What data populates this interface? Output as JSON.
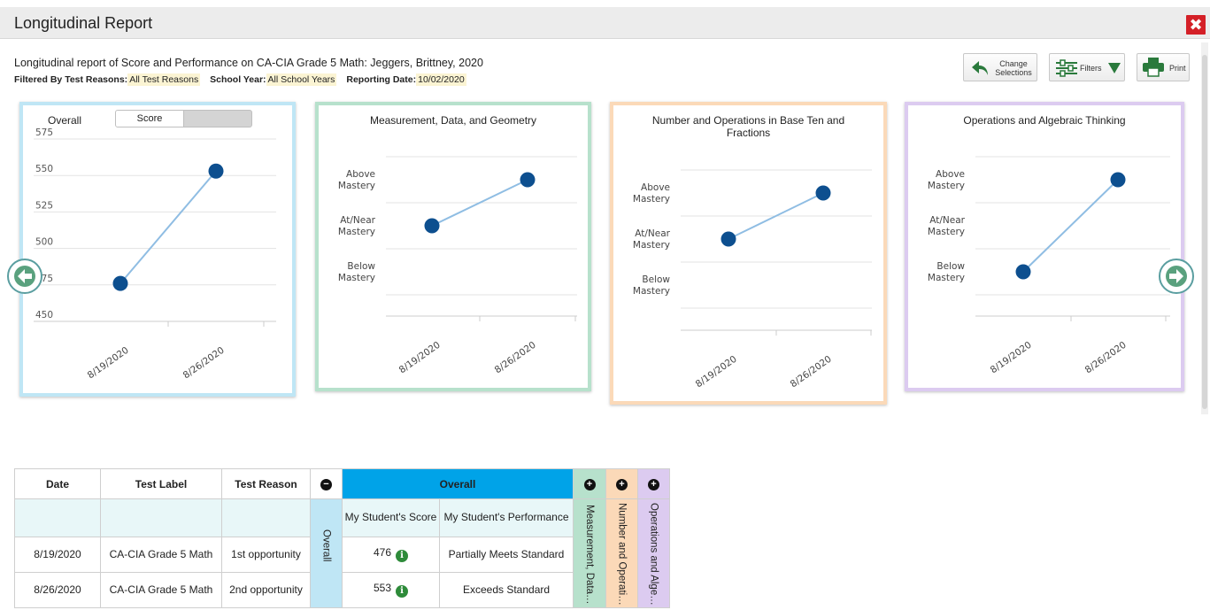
{
  "window": {
    "title": "Longitudinal Report",
    "close_icon": "close-icon"
  },
  "header": {
    "description": "Longitudinal report of Score and Performance on CA-CIA Grade 5 Math: Jeggers, Brittney, 2020",
    "filtered_by_label": "Filtered By",
    "filters": [
      {
        "label": "Test Reasons:",
        "value": "All Test Reasons"
      },
      {
        "label": "School Year:",
        "value": "All School Years"
      },
      {
        "label": "Reporting Date:",
        "value": "10/02/2020"
      }
    ]
  },
  "toolbar": {
    "change_line1": "Change",
    "change_line2": "Selections",
    "filters_label": "Filters",
    "print_label": "Print"
  },
  "colors": {
    "overall": "#bfe6f5",
    "measurement": "#b7e1cc",
    "number_ops": "#fbd9b8",
    "operations": "#dccbf0",
    "point": "#0d4f8f",
    "line": "#8fbde3",
    "header_blue": "#00a3e8"
  },
  "charts": {
    "overall": {
      "label": "Overall",
      "toggle_selected": "Score",
      "chart_data": {
        "type": "line",
        "x": [
          "8/19/2020",
          "8/26/2020"
        ],
        "values": [
          476,
          553
        ],
        "ylim": [
          450,
          575
        ],
        "yticks": [
          575,
          550,
          525,
          500,
          475,
          450
        ]
      }
    },
    "claims": [
      {
        "title": "Measurement, Data, and Geometry",
        "chart_data": {
          "type": "line",
          "x": [
            "8/19/2020",
            "8/26/2020"
          ],
          "levels": [
            "Above Mastery",
            "At/Near Mastery",
            "Below Mastery"
          ],
          "values": [
            "At/Near Mastery",
            "Above Mastery"
          ]
        }
      },
      {
        "title_line1": "Number and Operations in Base Ten and",
        "title_line2": "Fractions",
        "chart_data": {
          "type": "line",
          "x": [
            "8/19/2020",
            "8/26/2020"
          ],
          "levels": [
            "Above Mastery",
            "At/Near Mastery",
            "Below Mastery"
          ],
          "values": [
            "At/Near Mastery",
            "Above Mastery"
          ]
        }
      },
      {
        "title": "Operations and Algebraic Thinking",
        "chart_data": {
          "type": "line",
          "x": [
            "8/19/2020",
            "8/26/2020"
          ],
          "levels": [
            "Above Mastery",
            "At/Near Mastery",
            "Below Mastery"
          ],
          "values": [
            "Below Mastery",
            "Above Mastery"
          ]
        }
      }
    ]
  },
  "table": {
    "headers": {
      "date": "Date",
      "test_label": "Test Label",
      "test_reason": "Test Reason",
      "overall_group": "Overall",
      "overall_vertical": "Overall",
      "score": "My Student's Score",
      "performance": "My Student's Performance",
      "measurement": "Measurement, Data…",
      "number_ops": "Number and Operati…",
      "operations": "Operations and Alge…"
    },
    "toggles": {
      "overall": "−",
      "measurement": "+",
      "number_ops": "+",
      "operations": "+"
    },
    "rows": [
      {
        "date": "8/19/2020",
        "test_label": "CA-CIA Grade 5 Math",
        "test_reason": "1st opportunity",
        "score": "476",
        "performance": "Partially Meets Standard"
      },
      {
        "date": "8/26/2020",
        "test_label": "CA-CIA Grade 5 Math",
        "test_reason": "2nd opportunity",
        "score": "553",
        "performance": "Exceeds Standard"
      }
    ],
    "info_glyph": "i"
  }
}
